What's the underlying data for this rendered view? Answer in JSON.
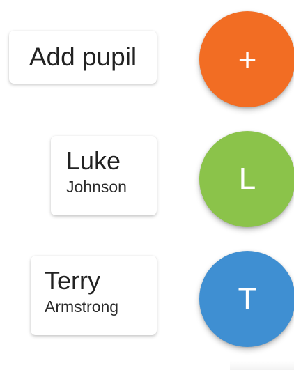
{
  "speed_dial": {
    "add": {
      "label": "Add pupil",
      "glyph": "+",
      "icon": "plus-icon",
      "color": "#F26D23"
    },
    "pupils": [
      {
        "first_name": "Luke",
        "last_name": "Johnson",
        "initial": "L",
        "color": "#8BC34A"
      },
      {
        "first_name": "Terry",
        "last_name": "Armstrong",
        "initial": "T",
        "color": "#3F8FD2"
      }
    ]
  }
}
